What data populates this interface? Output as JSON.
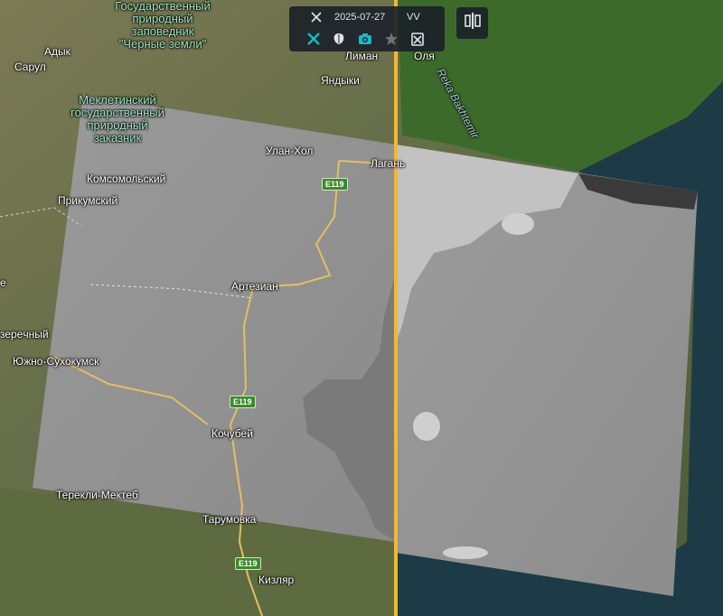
{
  "toolbar": {
    "date": "2025-07-27",
    "polarization": "VV",
    "icons": [
      "satellite-icon",
      "satellite-active-icon",
      "brain-icon",
      "camera-icon",
      "star-icon",
      "clipboard-icon"
    ]
  },
  "compare_button": {
    "icon": "split-compare-icon"
  },
  "colors": {
    "divider": "#f2b733",
    "accent": "#16b9c9",
    "road_badge": "#3d8a2c"
  },
  "labels": {
    "reserve_black_lands": "Государственный\nприродный\nзаповедник\n\"Черные земли\"",
    "meklet_reserve": "Меклетинский\nгосударственный\nприродный\nзаказник",
    "adyk": "Адык",
    "sarul": "Сарул",
    "liman": "Лиман",
    "olya": "Оля",
    "yandyki": "Яндыки",
    "reka_bakhtemir": "Reka Bakhtemir",
    "ulan_khol": "Улан-Хол",
    "lagan": "Лагань",
    "komsomolsky": "Комсомольский",
    "prikumsky": "Прикумский",
    "artezian": "Артезиан",
    "ozerechny": "зерeчный",
    "yuzhno_sukhokumsk": "Южно-Сухокумск",
    "kochubey": "Кочубей",
    "terekli_mekteb": "Терекли-Мектеб",
    "tarumovka": "Тарумовка",
    "kizlyar": "Кизляр",
    "left_edge_e": "е",
    "road_e119_a": "E119",
    "road_e119_b": "E119",
    "road_e119_c": "E119"
  }
}
